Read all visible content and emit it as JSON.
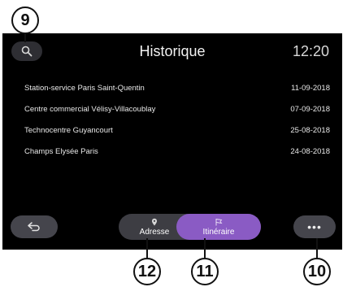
{
  "callouts": {
    "search": "9",
    "more": "10",
    "itineraire": "11",
    "adresse": "12"
  },
  "header": {
    "title": "Historique",
    "time": "12:20",
    "search_icon": "search-icon"
  },
  "history": [
    {
      "place": "Station-service Paris Saint-Quentin",
      "date": "11-09-2018"
    },
    {
      "place": "Centre commercial Vélisy-Villacoublay",
      "date": "07-09-2018"
    },
    {
      "place": "Technocentre Guyancourt",
      "date": "25-08-2018"
    },
    {
      "place": "Champs Elysée Paris",
      "date": "24-08-2018"
    }
  ],
  "bottom_bar": {
    "back_icon": "back-arrow-icon",
    "tabs": [
      {
        "label": "Adresse",
        "icon": "pin-icon",
        "active": false
      },
      {
        "label": "Itinéraire",
        "icon": "flag-icon",
        "active": true
      }
    ],
    "more_label": "•••"
  },
  "colors": {
    "screen_bg": "#000000",
    "accent": "#8a5bc4",
    "button_bg": "#45454c"
  }
}
